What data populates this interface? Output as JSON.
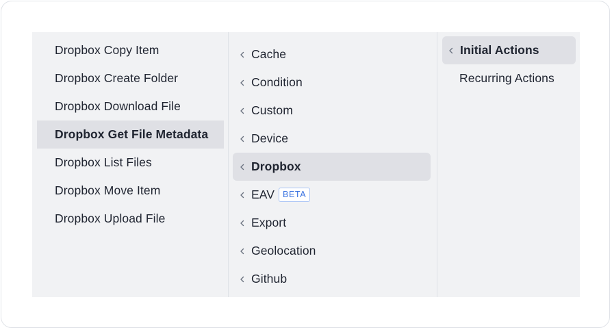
{
  "actions": {
    "items": [
      {
        "label": "Dropbox Copy Item"
      },
      {
        "label": "Dropbox Create Folder"
      },
      {
        "label": "Dropbox Download File"
      },
      {
        "label": "Dropbox Get File Metadata"
      },
      {
        "label": "Dropbox List Files"
      },
      {
        "label": "Dropbox Move Item"
      },
      {
        "label": "Dropbox Upload File"
      }
    ],
    "selected": "Dropbox Get File Metadata"
  },
  "categories": {
    "items": [
      {
        "label": "Cache"
      },
      {
        "label": "Condition"
      },
      {
        "label": "Custom"
      },
      {
        "label": "Device"
      },
      {
        "label": "Dropbox"
      },
      {
        "label": "EAV",
        "badge": "BETA"
      },
      {
        "label": "Export"
      },
      {
        "label": "Geolocation"
      },
      {
        "label": "Github"
      }
    ],
    "selected": "Dropbox",
    "icon": "chevron-left-icon"
  },
  "action_types": {
    "items": [
      {
        "label": "Initial Actions"
      },
      {
        "label": "Recurring Actions"
      }
    ],
    "selected": "Initial Actions",
    "icon": "chevron-left-icon"
  },
  "colors": {
    "panel_bg": "#f1f2f4",
    "selected_bg": "#dfe0e5",
    "text": "#1f2430",
    "badge": "#3b73e0"
  }
}
